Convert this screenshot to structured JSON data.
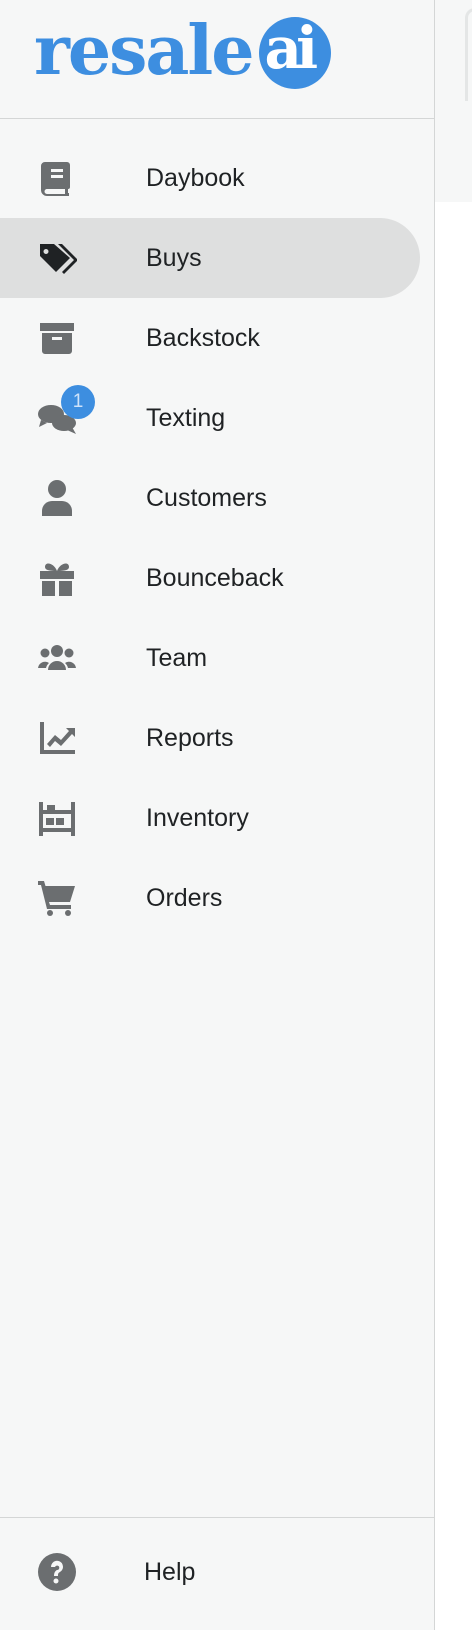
{
  "brand": {
    "name": "resale",
    "badge": "ai",
    "color": "#3d8ee0"
  },
  "nav": {
    "items": [
      {
        "label": "Daybook",
        "icon": "book-icon"
      },
      {
        "label": "Buys",
        "icon": "tags-icon",
        "active": true
      },
      {
        "label": "Backstock",
        "icon": "archive-box-icon"
      },
      {
        "label": "Texting",
        "icon": "chat-bubbles-icon",
        "badge": "1"
      },
      {
        "label": "Customers",
        "icon": "user-icon"
      },
      {
        "label": "Bounceback",
        "icon": "gift-icon"
      },
      {
        "label": "Team",
        "icon": "users-group-icon"
      },
      {
        "label": "Reports",
        "icon": "chart-line-icon"
      },
      {
        "label": "Inventory",
        "icon": "warehouse-shelf-icon"
      },
      {
        "label": "Orders",
        "icon": "shopping-cart-icon"
      }
    ]
  },
  "footer": {
    "help_label": "Help",
    "help_icon": "question-circle-icon"
  }
}
